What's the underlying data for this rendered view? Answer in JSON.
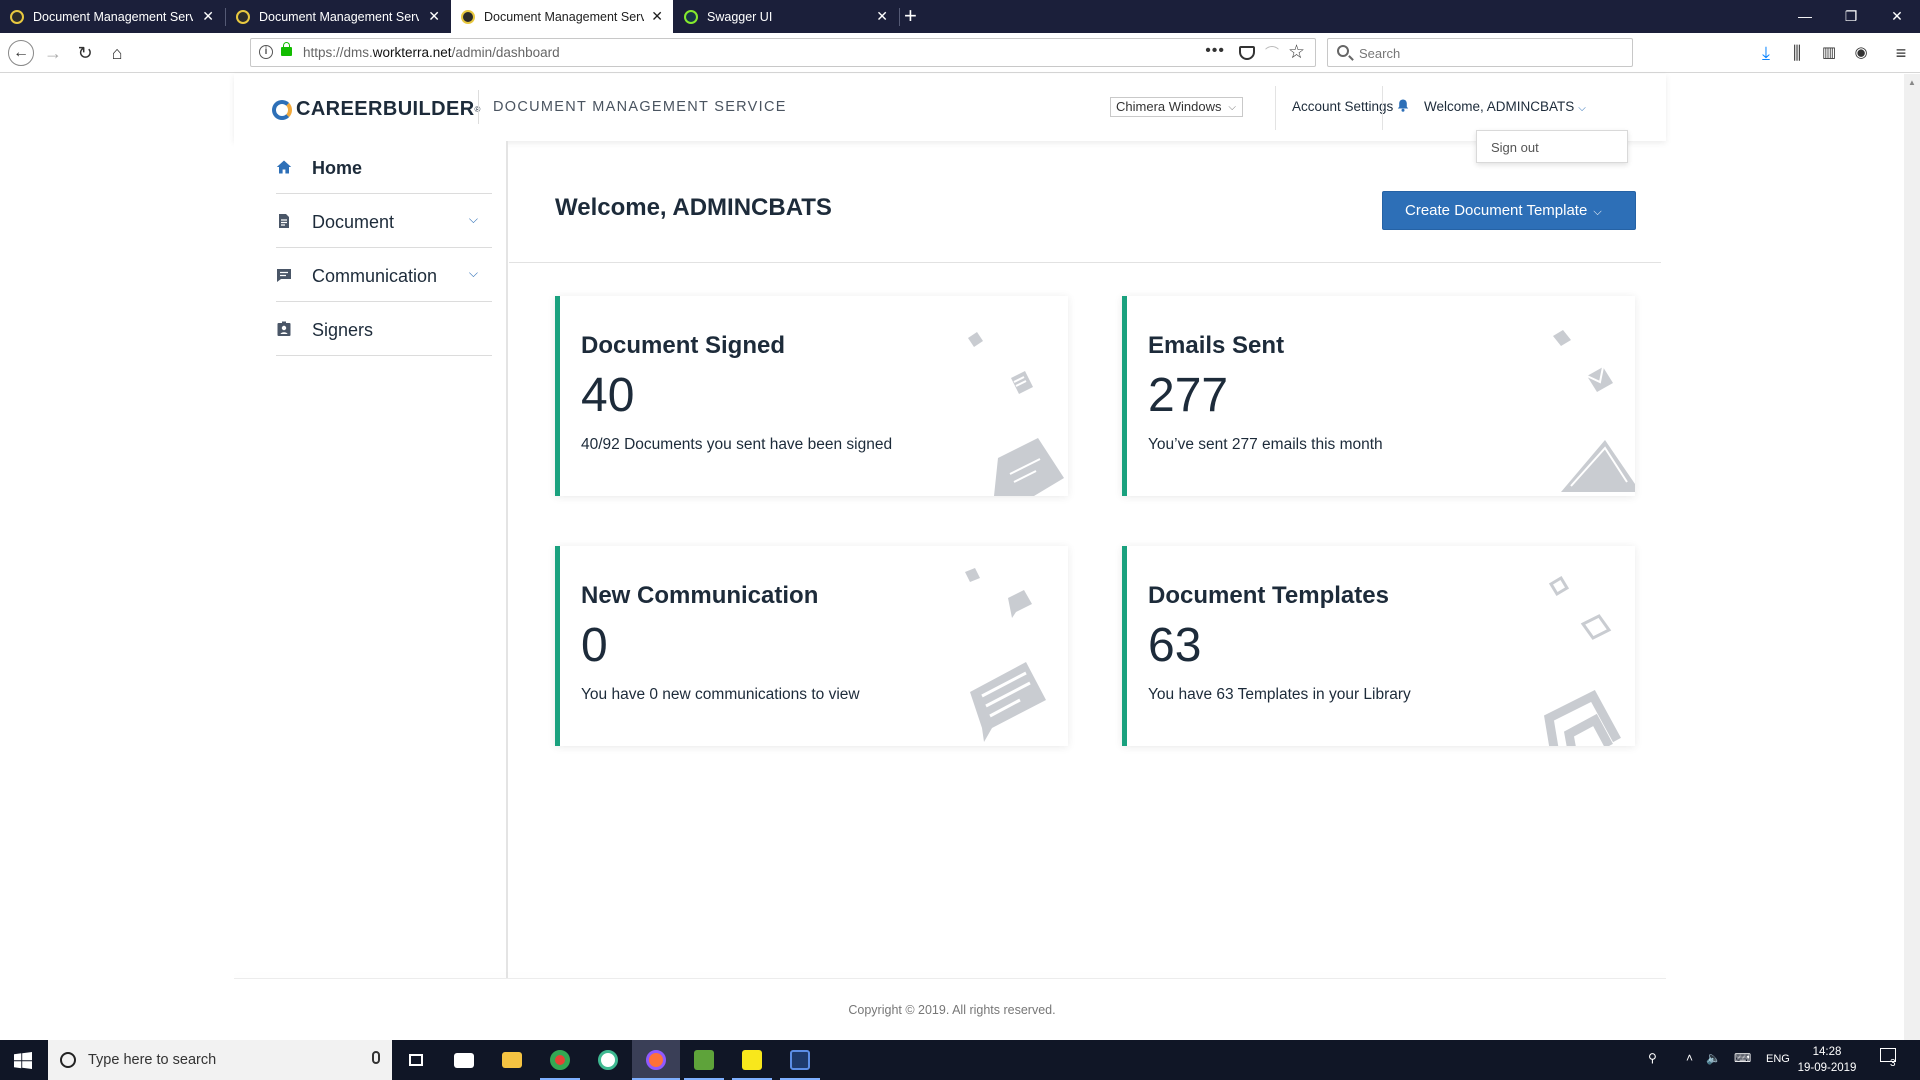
{
  "browser": {
    "tabs": [
      {
        "title": "Document Management Servic",
        "active": false
      },
      {
        "title": "Document Management Servic",
        "active": false
      },
      {
        "title": "Document Management Servic",
        "active": true
      },
      {
        "title": "Swagger UI",
        "active": false
      }
    ],
    "url_prefix": "https://dms.",
    "url_domain": "workterra.net",
    "url_path": "/admin/dashboard",
    "search_placeholder": "Search"
  },
  "header": {
    "logo_text": "CAREERBUILDER",
    "logo_mark": "®",
    "service_title": "DOCUMENT MANAGEMENT SERVICE",
    "tenant_selected": "Chimera Windows",
    "account_settings": "Account Settings",
    "welcome_user": "Welcome, ADMINCBATS",
    "dropdown_signout": "Sign out"
  },
  "sidebar": {
    "items": [
      {
        "label": "Home",
        "icon": "home-icon",
        "expandable": false
      },
      {
        "label": "Document",
        "icon": "document-icon",
        "expandable": true
      },
      {
        "label": "Communication",
        "icon": "chat-icon",
        "expandable": true
      },
      {
        "label": "Signers",
        "icon": "id-badge-icon",
        "expandable": false
      }
    ]
  },
  "main": {
    "title": "Welcome, ADMINCBATS",
    "create_button": "Create Document Template",
    "cards": [
      {
        "title": "Document Signed",
        "value": "40",
        "desc": "40/92 Documents you sent have been signed",
        "icon": "signed-document-icon"
      },
      {
        "title": "Emails Sent",
        "value": "277",
        "desc": "You’ve sent 277 emails this month",
        "icon": "envelope-icon"
      },
      {
        "title": "New Communication",
        "value": "0",
        "desc": "You have 0 new communications to view",
        "icon": "message-icon"
      },
      {
        "title": "Document Templates",
        "value": "63",
        "desc": "You have 63 Templates in your Library",
        "icon": "template-stack-icon"
      }
    ],
    "accent_color": "#1aa17e",
    "brand_blue": "#2d6fb7"
  },
  "footer": {
    "copyright": "Copyright © 2019. All rights reserved."
  },
  "taskbar": {
    "search_placeholder": "Type here to search",
    "language": "ENG",
    "time": "14:28",
    "date": "19-09-2019",
    "notifications": "3"
  }
}
